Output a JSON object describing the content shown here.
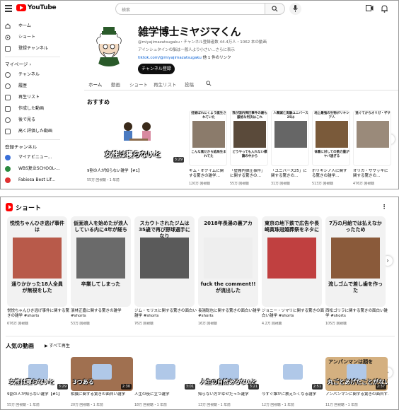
{
  "header": {
    "logo_text": "YouTube",
    "search_placeholder": "検索"
  },
  "sidebar": {
    "items": [
      {
        "label": "ホーム"
      },
      {
        "label": "ショート"
      },
      {
        "label": "登録チャンネル"
      }
    ],
    "mypage_label": "マイページ",
    "mypage_items": [
      {
        "label": "チャンネル"
      },
      {
        "label": "履歴"
      },
      {
        "label": "再生リスト"
      },
      {
        "label": "作成した動画"
      },
      {
        "label": "後で見る"
      },
      {
        "label": "高く評価した動画"
      }
    ],
    "subs_label": "登録チャンネル",
    "subs": [
      {
        "label": "マイナビニュー...",
        "color": "#3a6fd8"
      },
      {
        "label": "WBS复业SCHOOL-...",
        "color": "#2b8a3e"
      },
      {
        "label": "Fabiosa Best Lif...",
        "color": "#e03131"
      }
    ]
  },
  "channel": {
    "name": "雑学博士ミヤジマくん",
    "meta": "@miyajimazatsugaku・チャンネル登録者数 44.4万人・1062 本の動画",
    "description": "アインシュタインの脳は一般人より小さい...さらに表示",
    "link": "tiktok.com/@miyajimazatsugaku",
    "link_suffix": "他 1 件のリンク",
    "subscribe_label": "チャンネル登録"
  },
  "tabs": [
    "ホーム",
    "動画",
    "ショート",
    "再生リスト",
    "投稿"
  ],
  "recommended": {
    "title": "おすすめ",
    "featured": {
      "caption": "女性は寝らないと",
      "duration": "3:29",
      "title": "9割の人が知らない雑学【#1】",
      "meta": "55万 回視聴・1 年前"
    },
    "minis": [
      {
        "cap_top": "妊娠ばれにくよう誕生されていた",
        "cap_bot": "こんな風だから結局生まれてた",
        "title": "ギム・オクイムに関する驚きの雑学…",
        "meta": "120万 回視聴",
        "color": "#8b7b6b"
      },
      {
        "cap_top": "我が国内弾圧事件の最も厳格な判決はこれ",
        "cap_bot": "どうやっても入れない標識の中から",
        "title": "「壁棚内弾圧事件」に関する驚きの…",
        "meta": "55万 回視聴",
        "color": "#5a4a3a"
      },
      {
        "cap_top": "人類滅亡実験ユニバース25は",
        "cap_bot": "",
        "title": "「ユニバース25」に関する驚きの…",
        "meta": "31万 回視聴",
        "color": "#666666"
      },
      {
        "cap_top": "地上最強の生物ボリキシア人",
        "cap_bot": "体重に対しての筋力量がヤバ過ぎる",
        "title": "ボリキシア人に関する驚きの雑学…",
        "meta": "513万 回視聴",
        "color": "#7a5a3a"
      },
      {
        "cap_top": "逃ぐてからオリガ・ザサ",
        "cap_bot": "",
        "title": "オリガ・ザサッキに関する驚きの…",
        "meta": "476万 回視聴",
        "color": "#9a8a7a"
      }
    ]
  },
  "shorts": {
    "title": "ショート",
    "items": [
      {
        "top": "悦悦ちゃんひき逃げ事件は",
        "bottom": "通りかかった18人全員が無視をした",
        "title": "悦悦ちゃんひき逃げ事件に関する驚きの雑学 #shorts",
        "views": "676万 回視聴",
        "color": "#b85a4a"
      },
      {
        "top": "仮面浪人を始めたが浪人している内に4年が経ち",
        "bottom": "卒業してしまった",
        "title": "濱林正嘉に関する驚きの雑学 #shorts",
        "views": "53万 回視聴",
        "color": "#6a6a6a"
      },
      {
        "top": "スカウトされたジムは35歳で再び野球選手になり",
        "bottom": "",
        "title": "ジム・モリスに関する驚きの面白い雑学 #shorts",
        "views": "76万 回視聴",
        "color": "#5a5a5a"
      },
      {
        "top": "2018年長湯の裏アカ",
        "bottom": "fuck the comment!!が流出した",
        "title": "長湯聡也に関する驚きの面白い雑学 #shorts",
        "views": "16万 回視聴",
        "color": "#eeeeee"
      },
      {
        "top": "東京の地下鉄で広告や長崎真珠冠婚葬祭をネタに",
        "bottom": "",
        "title": "ジョニー・ソマリに関する驚きの面白い雑学 #shorts",
        "views": "4.2万 回視聴",
        "color": "#c04040"
      },
      {
        "top": "7万の月給では払えなかったため",
        "bottom": "流しゴムで差し歯を作った",
        "title": "西松ゴリラに関する驚きの面白い雑学 #shorts",
        "views": "105万 回視聴",
        "color": "#8a5a3a"
      }
    ]
  },
  "popular": {
    "title": "人気の動画",
    "play_all": "すべて再生",
    "items": [
      {
        "title": "9割の人が知らない雑学【#1】",
        "meta": "55万 回視聴・1 年前",
        "duration": "3:29",
        "caption": "女性は寝らないと",
        "color": "#ffffff"
      },
      {
        "title": "相撲に関する驚きの面白い雑学",
        "meta": "20万 回視聴・1 年前",
        "duration": "2:30",
        "caption": "3つある",
        "color": "#a07050"
      },
      {
        "title": "人生の役に立つ雑学",
        "meta": "18万 回視聴・1 年前",
        "duration": "3:01",
        "caption": "",
        "color": "#ffffff"
      },
      {
        "title": "知らない方が幸せだった雑学",
        "meta": "13万 回視聴・1 年前",
        "duration": "3:21",
        "caption": "人生の自然あるないと",
        "color": "#ffffff"
      },
      {
        "title": "今すぐ誰かに教えたくなる雑学",
        "meta": "12万 回視聴・1 年前",
        "duration": "2:51",
        "caption": "",
        "color": "#ffffff"
      },
      {
        "title": "アンパンマンに関する驚きの面白す…",
        "meta": "11万 回視聴・1 年前",
        "duration": "2:37",
        "caption": "丸ごとあげたことがない",
        "top": "アンパンマンは顔を",
        "color": "#d4b080"
      }
    ]
  },
  "colors": {
    "brand": "#ff0000",
    "link": "#065fd4",
    "muted": "#606060"
  }
}
